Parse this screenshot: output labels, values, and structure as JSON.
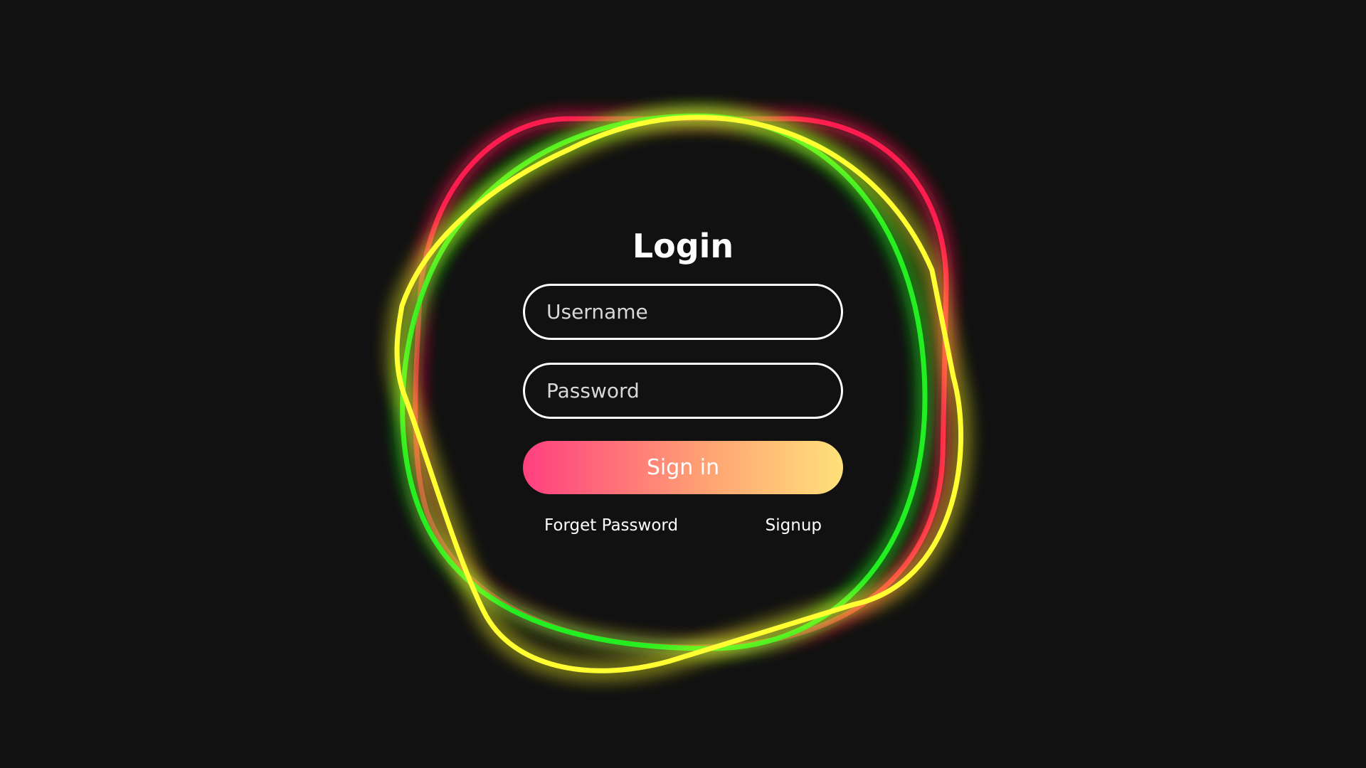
{
  "login": {
    "title": "Login",
    "username_placeholder": "Username",
    "password_placeholder": "Password",
    "signin_label": "Sign in",
    "forgot_label": "Forget Password",
    "signup_label": "Signup"
  },
  "colors": {
    "background": "#111111",
    "ring_red": "#ff1f4f",
    "ring_green": "#22ee22",
    "ring_yellow": "#ffff33",
    "button_gradient": [
      "#ff3f80",
      "#ff9f73",
      "#ffe17a"
    ]
  }
}
